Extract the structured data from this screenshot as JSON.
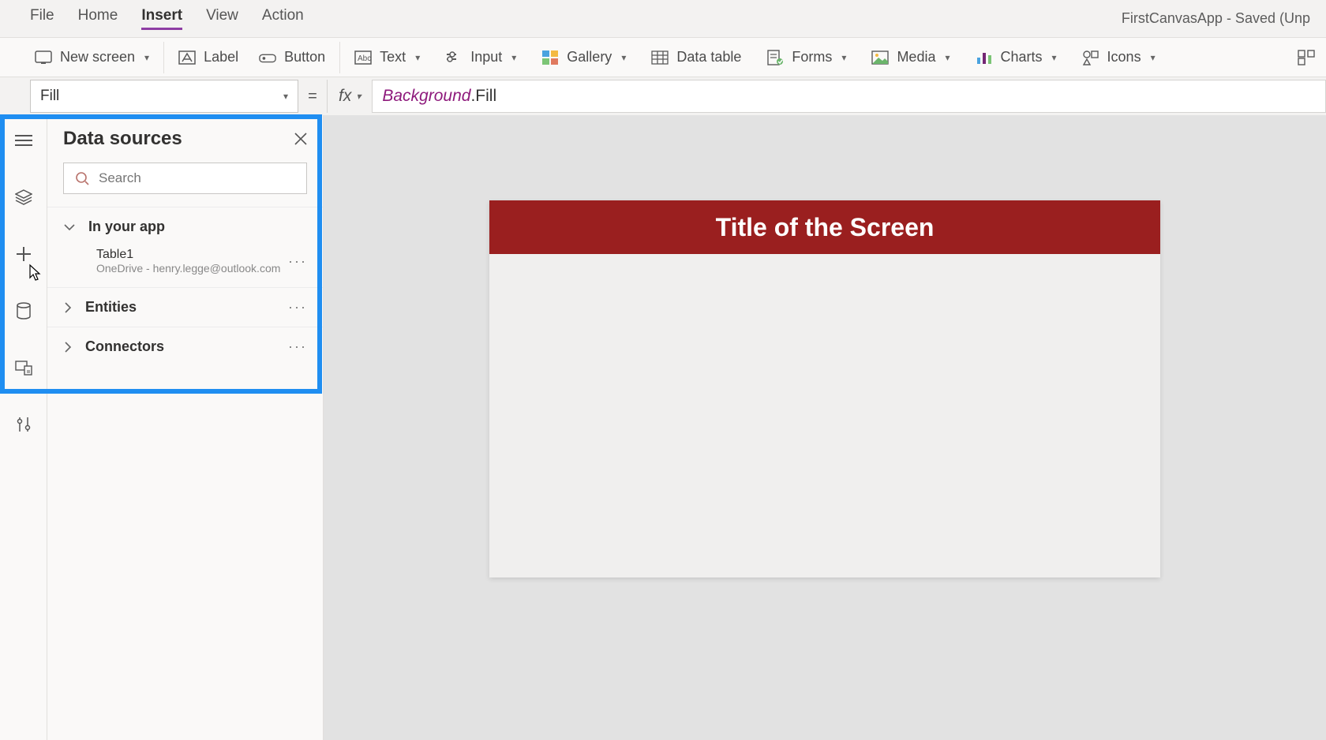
{
  "menu": {
    "items": [
      "File",
      "Home",
      "Insert",
      "View",
      "Action"
    ],
    "activeIndex": 2
  },
  "app_title": "FirstCanvasApp - Saved (Unp",
  "ribbon": {
    "new_screen": "New screen",
    "label": "Label",
    "button": "Button",
    "text": "Text",
    "input": "Input",
    "gallery": "Gallery",
    "data_table": "Data table",
    "forms": "Forms",
    "media": "Media",
    "charts": "Charts",
    "icons": "Icons"
  },
  "formula": {
    "property": "Fill",
    "fx_label": "fx",
    "expr_ident": "Background",
    "expr_prop": "Fill"
  },
  "data_panel": {
    "title": "Data sources",
    "search_placeholder": "Search",
    "in_your_app": "In your app",
    "table1": {
      "name": "Table1",
      "sub": "OneDrive - henry.legge@outlook.com"
    },
    "entities": "Entities",
    "connectors": "Connectors"
  },
  "canvas": {
    "title": "Title of the Screen"
  }
}
